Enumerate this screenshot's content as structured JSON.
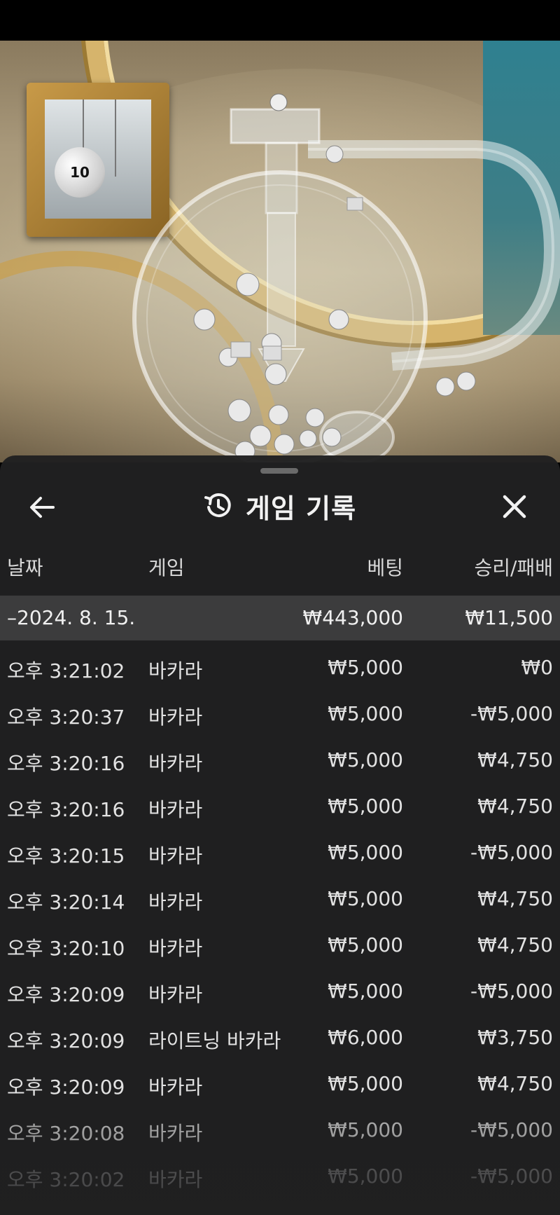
{
  "sheet": {
    "title": "게임 기록",
    "icons": {
      "back": "arrow-left-icon",
      "history": "history-icon",
      "close": "close-icon"
    }
  },
  "video": {
    "monitor_ball": "10"
  },
  "columns": {
    "date": "날짜",
    "game": "게임",
    "bet": "베팅",
    "win_loss": "승리/패배"
  },
  "group": {
    "date": "–2024. 8. 15.",
    "bet_total": "₩443,000",
    "win_total": "₩11,500"
  },
  "rows": [
    {
      "time": "오후 3:21:02",
      "game": "바카라",
      "bet": "₩5,000",
      "result": "₩0"
    },
    {
      "time": "오후 3:20:37",
      "game": "바카라",
      "bet": "₩5,000",
      "result": "-₩5,000"
    },
    {
      "time": "오후 3:20:16",
      "game": "바카라",
      "bet": "₩5,000",
      "result": "₩4,750"
    },
    {
      "time": "오후 3:20:16",
      "game": "바카라",
      "bet": "₩5,000",
      "result": "₩4,750"
    },
    {
      "time": "오후 3:20:15",
      "game": "바카라",
      "bet": "₩5,000",
      "result": "-₩5,000"
    },
    {
      "time": "오후 3:20:14",
      "game": "바카라",
      "bet": "₩5,000",
      "result": "₩4,750"
    },
    {
      "time": "오후 3:20:10",
      "game": "바카라",
      "bet": "₩5,000",
      "result": "₩4,750"
    },
    {
      "time": "오후 3:20:09",
      "game": "바카라",
      "bet": "₩5,000",
      "result": "-₩5,000"
    },
    {
      "time": "오후 3:20:09",
      "game": "라이트닝 바카라",
      "bet": "₩6,000",
      "result": "₩3,750"
    },
    {
      "time": "오후 3:20:09",
      "game": "바카라",
      "bet": "₩5,000",
      "result": "₩4,750"
    },
    {
      "time": "오후 3:20:08",
      "game": "바카라",
      "bet": "₩5,000",
      "result": "-₩5,000"
    },
    {
      "time": "오후 3:20:02",
      "game": "바카라",
      "bet": "₩5,000",
      "result": "-₩5,000"
    }
  ],
  "colors": {
    "sheet_bg": "#202021",
    "group_bg": "#3c3c3d",
    "text": "#e2e2e2",
    "gold": "#c89a48"
  }
}
